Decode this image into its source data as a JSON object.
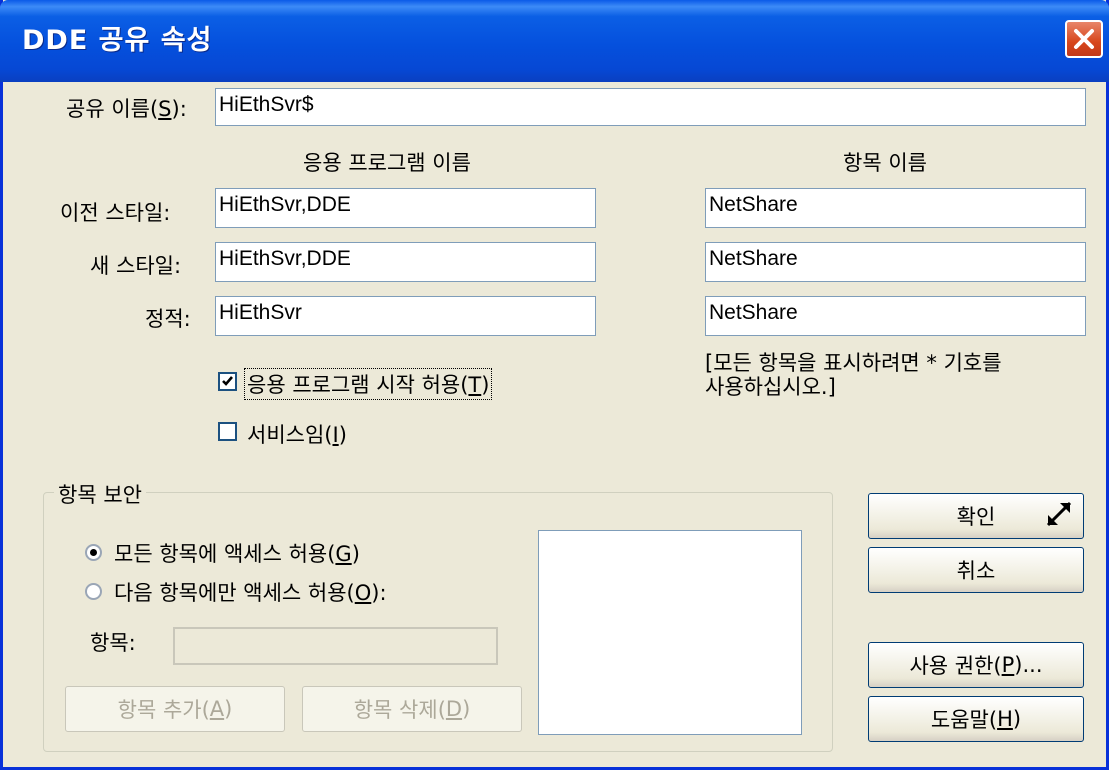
{
  "window": {
    "title": "DDE 공유 속성",
    "close_icon": "close-icon"
  },
  "share_name": {
    "label_prefix": "공유 이름(",
    "label_key": "S",
    "label_suffix": "):",
    "value": "HiEthSvr$"
  },
  "columns": {
    "app_name": "응용 프로그램 이름",
    "item_name": "항목 이름"
  },
  "rows": [
    {
      "label": "이전 스타일:",
      "app": "HiEthSvr,DDE",
      "item": "NetShare"
    },
    {
      "label": "새 스타일:",
      "app": "HiEthSvr,DDE",
      "item": "NetShare"
    },
    {
      "label": "정적:",
      "app": "HiEthSvr",
      "item": "NetShare"
    }
  ],
  "hint": {
    "line1": "[모든 항목을 표시하려면 * 기호를",
    "line2": "사용하십시오.]"
  },
  "checkboxes": {
    "allow_start": {
      "prefix": "응용 프로그램 시작 허용(",
      "key": "T",
      "suffix": ")",
      "checked": true
    },
    "is_service": {
      "prefix": "서비스임(",
      "key": "I",
      "suffix": ")",
      "checked": false
    }
  },
  "item_security": {
    "title": "항목 보안",
    "radio_all": {
      "prefix": "모든 항목에 액세스 허용(",
      "key": "G",
      "suffix": ")",
      "selected": true
    },
    "radio_only": {
      "prefix": "다음 항목에만 액세스 허용(",
      "key": "O",
      "suffix": "):",
      "selected": false
    },
    "item_label": "항목:",
    "item_value": "",
    "add_button": {
      "prefix": "항목 추가(",
      "key": "A",
      "suffix": ")"
    },
    "remove_button": {
      "prefix": "항목 삭제(",
      "key": "D",
      "suffix": ")"
    }
  },
  "buttons": {
    "ok": "확인",
    "cancel": "취소",
    "permissions": {
      "prefix": "사용 권한(",
      "key": "P",
      "suffix": ")..."
    },
    "help": {
      "prefix": "도움말(",
      "key": "H",
      "suffix": ")"
    }
  },
  "colors": {
    "title_bar": "#0550dd",
    "dialog_bg": "#ece9d8",
    "close_button": "#d7461b",
    "field_border": "#7f9db9"
  }
}
